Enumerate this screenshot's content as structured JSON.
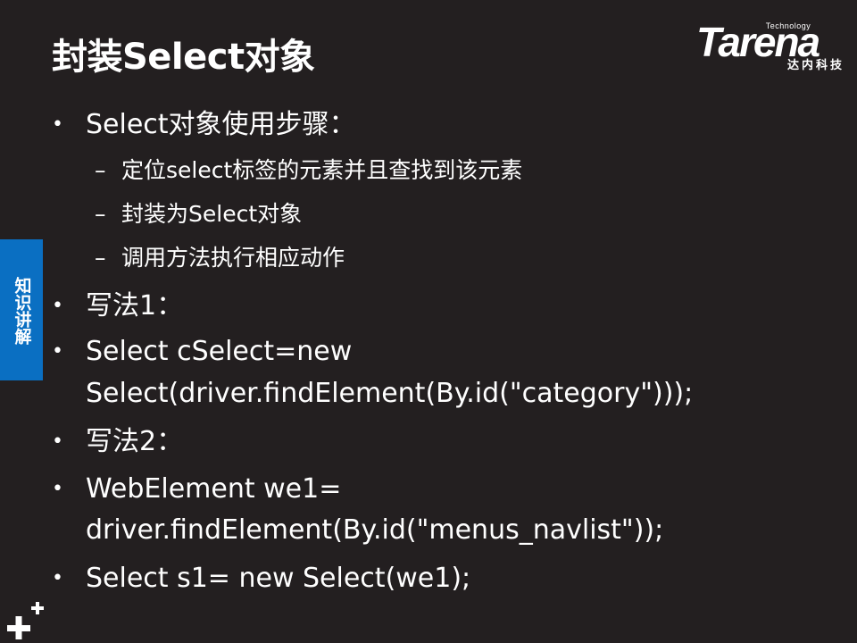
{
  "slide": {
    "title": "封装Select对象",
    "side_tab_label": "知识讲解",
    "logo": {
      "tagline": "Technology",
      "wordmark": "Tarena",
      "chinese": "达内科技"
    },
    "bullets": [
      {
        "level": 1,
        "text": "Select对象使用步骤："
      },
      {
        "level": 2,
        "text": "定位select标签的元素并且查找到该元素"
      },
      {
        "level": 2,
        "text": "封装为Select对象"
      },
      {
        "level": 2,
        "text": "调用方法执行相应动作"
      },
      {
        "level": 1,
        "text": "写法1："
      },
      {
        "level": 1,
        "text": "Select cSelect=new"
      },
      {
        "level": 1,
        "continuation": true,
        "text": "Select(driver.findElement(By.id(\"category\")));"
      },
      {
        "level": 1,
        "text": "写法2："
      },
      {
        "level": 1,
        "text": "WebElement we1="
      },
      {
        "level": 1,
        "continuation": true,
        "text": "driver.findElement(By.id(\"menus_navlist\"));"
      },
      {
        "level": 1,
        "text": "Select s1= new Select(we1);"
      }
    ],
    "bullet_glyph": "•",
    "dash_glyph": "–"
  },
  "colors": {
    "background": "#231f20",
    "text": "#ffffff",
    "side_tab": "#0a6fc2"
  }
}
